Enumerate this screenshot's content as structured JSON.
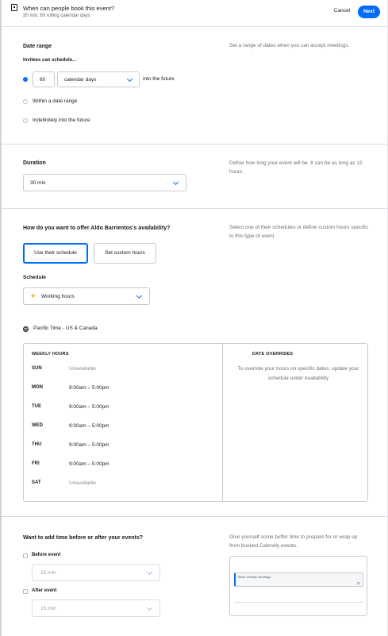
{
  "header": {
    "title": "When can people book this event?",
    "subtitle": "30 min, 60 rolling calendar days",
    "cancel_label": "Cancel",
    "next_label": "Next"
  },
  "date_range": {
    "title": "Date range",
    "description": "Set a range of dates when you can accept meetings.",
    "invitees_label": "Invitees can schedule...",
    "days_value": "60",
    "unit_value": "calendar days",
    "suffix": "into the future",
    "option_date_range": "Within a date range",
    "option_indefinitely": "Indefinitely into the future"
  },
  "duration": {
    "title": "Duration",
    "description": "Define how long your event will be. It can be as long as 12 hours.",
    "value": "30 min"
  },
  "availability": {
    "title": "How do you want to offer Aldo Barrientos's availability?",
    "description": "Select one of their schedules or define custom hours specific to this type of event.",
    "use_schedule_label": "Use their schedule",
    "custom_hours_label": "Set custom hours",
    "schedule_label": "Schedule",
    "schedule_value": "Working hours",
    "timezone": "Pacific Time - US & Canada",
    "weekly_hours_header": "WEEKLY HOURS",
    "date_overrides_header": "DATE OVERRIDES",
    "overrides_text": "To override your hours on specific dates, update your schedule under Availability",
    "days": [
      {
        "day": "SUN",
        "hours": "Unavailable"
      },
      {
        "day": "MON",
        "hours": "9:00am – 5:00pm"
      },
      {
        "day": "TUE",
        "hours": "9:00am – 5:00pm"
      },
      {
        "day": "WED",
        "hours": "9:00am – 5:00pm"
      },
      {
        "day": "THU",
        "hours": "9:00am – 5:00pm"
      },
      {
        "day": "FRI",
        "hours": "9:00am – 5:00pm"
      },
      {
        "day": "SAT",
        "hours": "Unavailable"
      }
    ]
  },
  "buffer": {
    "title": "Want to add time before or after your events?",
    "description": "Give yourself some buffer time to prepare for or wrap up from booked Calendly events.",
    "before_label": "Before event",
    "before_value": "15 min",
    "after_label": "After event",
    "after_value": "15 min",
    "preview_event": "Maze Weekly Meetings"
  },
  "colors": {
    "accent": "#006bff",
    "star": "#f5b300"
  }
}
